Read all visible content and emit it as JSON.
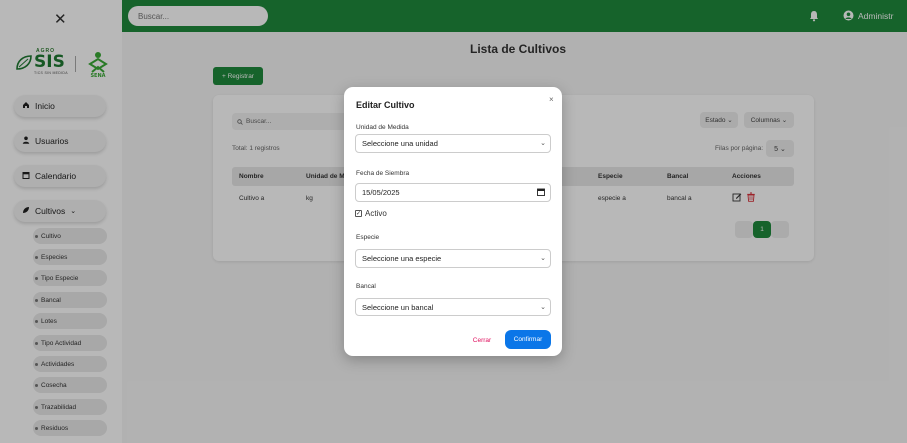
{
  "sidebar": {
    "close_icon": "close-icon",
    "logo": {
      "agro": "AGRO",
      "sis": "SIS",
      "tagline": "TICS SIN MEDIDA"
    },
    "items": [
      {
        "label": "Inicio",
        "icon": "home-icon"
      },
      {
        "label": "Usuarios",
        "icon": "user-icon"
      },
      {
        "label": "Calendario",
        "icon": "calendar-icon"
      },
      {
        "label": "Cultivos",
        "icon": "leaf-icon",
        "chevron": "⌄"
      }
    ],
    "subitems": [
      "Cultivo",
      "Especies",
      "Tipo Especie",
      "Bancal",
      "Lotes",
      "Tipo Actividad",
      "Actividades",
      "Cosecha",
      "Trazabilidad",
      "Residuos"
    ]
  },
  "topbar": {
    "search_placeholder": "Buscar...",
    "user_name": "Administr"
  },
  "page": {
    "title": "Lista de Cultivos",
    "register_label": "+ Registrar",
    "table_search_placeholder": "Buscar...",
    "estado_label": "Estado ⌄",
    "columnas_label": "Columnas ⌄",
    "total_label": "Total: 1 registros",
    "per_page_label": "Filas por página:",
    "per_page_value": "5 ⌄",
    "columns": [
      "Nombre",
      "Unidad de M",
      "Especie",
      "Bancal",
      "Acciones"
    ],
    "rows": [
      {
        "nombre": "Cultivo a",
        "unidad": "kg",
        "especie": "especie a",
        "bancal": "bancal a"
      }
    ],
    "current_page": "1"
  },
  "modal": {
    "title": "Editar Cultivo",
    "close_symbol": "×",
    "unidad_label": "Unidad de Medida",
    "unidad_value": "Seleccione una unidad",
    "fecha_label": "Fecha de Siembra",
    "fecha_value": "15/05/2025",
    "activo_label": "Activo",
    "activo_checked": true,
    "especie_label": "Especie",
    "especie_value": "Seleccione una especie",
    "bancal_label": "Bancal",
    "bancal_value": "Seleccione un bancal",
    "cerrar_label": "Cerrar",
    "confirmar_label": "Confirmar"
  },
  "colors": {
    "brand_green": "#1f8a3c",
    "confirm_blue": "#0b76e8",
    "cerrar_pink": "#e0115f"
  }
}
